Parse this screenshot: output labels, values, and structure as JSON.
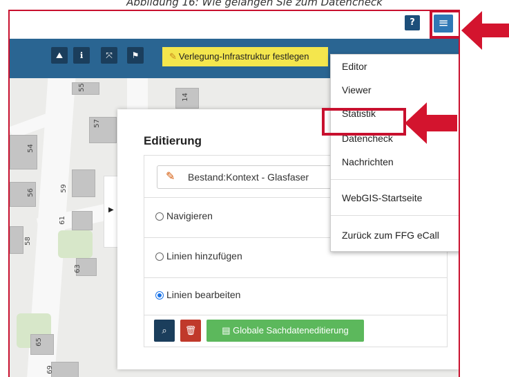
{
  "caption": "Abbildung 16: Wie gelangen Sie zum Datencheck",
  "topbar": {
    "help_icon": "question-circle-icon",
    "help_glyph": "?",
    "menu_icon": "hamburger-menu-icon",
    "menu_glyph": "≡"
  },
  "toolbar": {
    "tools": [
      {
        "icon": "map-marker-icon",
        "glyph": "⛰"
      },
      {
        "icon": "info-icon",
        "glyph": "ℹ"
      },
      {
        "icon": "expand-icon",
        "glyph": "⤧"
      },
      {
        "icon": "flag-icon",
        "glyph": "⚑"
      }
    ],
    "task_label": "Verlegung-Infrastruktur festlegen"
  },
  "map": {
    "house_numbers": [
      "55",
      "14",
      "57",
      "54",
      "59",
      "56",
      "61",
      "58",
      "63",
      "65",
      "69"
    ]
  },
  "panel": {
    "title": "Editierung",
    "layer_label": "Bestand:Kontext - Glasfaser",
    "options": [
      {
        "label": "Navigieren",
        "selected": false
      },
      {
        "label": "Linien hinzufügen",
        "selected": false
      },
      {
        "label": "Linien bearbeiten",
        "selected": true
      }
    ],
    "buttons": {
      "search_icon": "search-icon",
      "delete_icon": "trash-icon",
      "edit_all_label": "Globale Sachdateneditierung"
    }
  },
  "menu": {
    "items": [
      {
        "label": "Editor"
      },
      {
        "label": "Viewer"
      },
      {
        "label": "Statistik"
      },
      {
        "label": "Datencheck"
      },
      {
        "label": "Nachrichten"
      },
      {
        "label": "WebGIS-Startseite"
      },
      {
        "label": "Zurück zum FFG eCall"
      }
    ]
  },
  "colors": {
    "highlight": "#c8102e",
    "toolbar": "#2a6592",
    "menu_button": "#2f78b5",
    "task_badge": "#f4e64d",
    "green_button": "#5cb85c",
    "red_button": "#c0392b",
    "dark_button": "#1b3e5c"
  }
}
